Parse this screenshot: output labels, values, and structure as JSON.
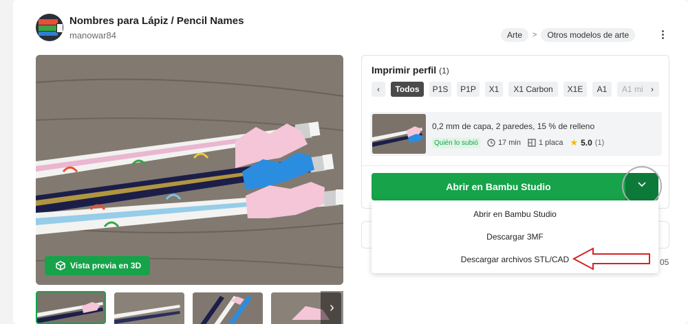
{
  "model": {
    "title": "Nombres para Lápiz / Pencil Names",
    "author": "manowar84"
  },
  "breadcrumb": {
    "items": [
      "Arte",
      "Otros modelos de arte"
    ],
    "separator": ">"
  },
  "gallery": {
    "preview_3d_label": "Vista previa en 3D",
    "next_arrow": "›"
  },
  "print_profile": {
    "title": "Imprimir perfil",
    "count": "(1)",
    "prev_arrow": "‹",
    "next_arrow": "›",
    "filters": [
      "Todos",
      "P1S",
      "P1P",
      "X1",
      "X1 Carbon",
      "X1E",
      "A1",
      "A1 mi"
    ],
    "active_filter": "Todos",
    "profile": {
      "description": "0,2 mm de capa, 2 paredes, 15 % de relleno",
      "uploader_tag": "Quién lo subió",
      "time": "17 min",
      "plates": "1 placa",
      "rating": "5.0",
      "rating_count": "(1)"
    }
  },
  "actions": {
    "open_label": "Abrir en Bambu Studio",
    "dropdown_icon": "chevron-down-icon",
    "menu": [
      "Abrir en Bambu Studio",
      "Descargar 3MF",
      "Descargar archivos STL/CAD"
    ]
  },
  "partial_text": "05",
  "colors": {
    "accent": "#16a34a",
    "accent_dark": "#0d7a3a",
    "arrow_red": "#d92121"
  }
}
